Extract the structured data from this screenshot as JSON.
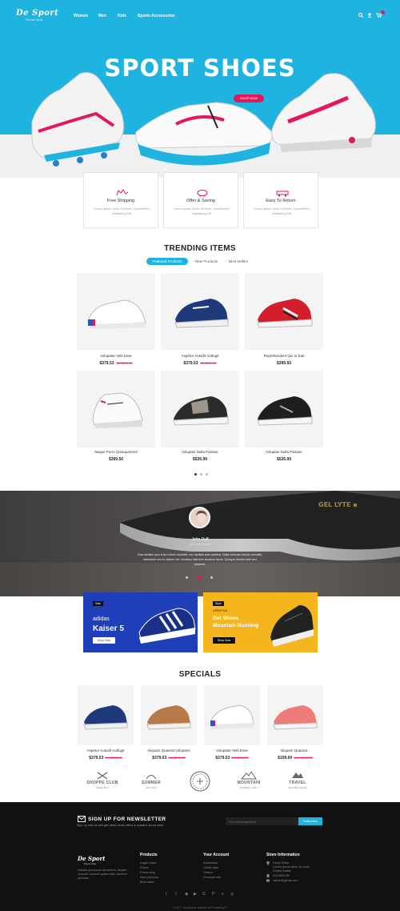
{
  "header": {
    "logo": "De Sport",
    "logo_sub": "Finest Club",
    "nav": [
      "Women",
      "Men",
      "Kids",
      "Sports Accessories"
    ],
    "icons": [
      "search-icon",
      "user-icon",
      "cart-icon"
    ]
  },
  "hero": {
    "title": "SPORT SHOES",
    "button": "SHOP NOW"
  },
  "features": [
    {
      "title": "Free Shipping",
      "desc": "Lorem ipsum Dolor Sit Amet, Consectetur Adipiscing Elit",
      "icon": "truck-icon"
    },
    {
      "title": "Offer & Saving",
      "desc": "Lorem ipsum Dolor Sit Amet, Consectetur Adipiscing Elit",
      "icon": "piggy-bank-icon"
    },
    {
      "title": "Easy To Return",
      "desc": "Lorem ipsum Dolor Sit Amet, Consectetur Adipiscing Elit",
      "icon": "return-icon"
    }
  ],
  "trending": {
    "title": "TRENDING ITEMS",
    "tabs": [
      "Featured Products",
      "New Products",
      "Best Sellers"
    ],
    "products": [
      {
        "name": "Voluptate Velit Esse",
        "price": "$379.53",
        "old_price": "$5 $399.50"
      },
      {
        "name": "Aspetur Autodit Autfugit",
        "price": "$379.53",
        "old_price": "$5 $399.50"
      },
      {
        "name": "Reprehenderit Qui In Eait",
        "price": "$399.50",
        "old_price": ""
      },
      {
        "name": "Neque Porro Quisquament",
        "price": "$399.50",
        "old_price": ""
      },
      {
        "name": "Voluptas Nulla Pariatur",
        "price": "$526.99",
        "old_price": ""
      },
      {
        "name": "Voluptas Nulla Pariatur",
        "price": "$526.99",
        "old_price": ""
      }
    ]
  },
  "testimonial": {
    "name": "John Duff",
    "role": "CEO and founder",
    "quote": "Duis facilisis arcu a leo rutrum molestie, nec facilisis ante pulvinar. Nulla vehicula mauris convallis, bibendum orci in, dictum est. Vivamus interdum faucibus lacus. Quisque laoreet ante sed placerat."
  },
  "banners": [
    {
      "tag": "Sale",
      "line1": "adidas",
      "line2": "Kaiser 5",
      "button": "Shop Now"
    },
    {
      "tag": "Style",
      "kicker": "LIFESTYLE",
      "line1": "Get Shoes",
      "line2": "Mountain Running",
      "button": "Shop Now"
    }
  ],
  "specials": {
    "title": "SPECIALS",
    "products": [
      {
        "name": "Aspetur Autodit Autfugit",
        "price": "$379.53",
        "old_price": "5% $399.50"
      },
      {
        "name": "Aliquam Quaerat Voluptem",
        "price": "$379.53",
        "old_price": "5% $399.50"
      },
      {
        "name": "Voluptate Velit Esse",
        "price": "$379.53",
        "old_price": "5% $399.50"
      },
      {
        "name": "Aliquam Quaerat...",
        "price": "$159.60",
        "old_price": "20% $199.50"
      }
    ]
  },
  "brands": [
    {
      "name": "SHOPPE CLUB",
      "sub": "SINCE 2017"
    },
    {
      "name": "SUMMER",
      "sub": "EST. 2017"
    },
    {
      "name": "",
      "sub": ""
    },
    {
      "name": "MOUNTAIN",
      "sub": "CLIMBING • 2017"
    },
    {
      "name": "TRAVEL",
      "sub": "WALKING SHOES"
    }
  ],
  "footer": {
    "newsletter_title": "SIGN UP FOR NEWSLETTER",
    "newsletter_desc": "Sign up with us and get latest deals,offers & updates about store.",
    "input_placeholder": "Your email address",
    "subscribe": "Subscribe",
    "about": "Claritas processus dynamicus, sequitu consuet, consuet system alter ulmeleni pecunes.",
    "products_title": "Products",
    "products_links": [
      "Legal notice",
      "Prices",
      "Prices drop",
      "New products",
      "Best sales"
    ],
    "account_title": "Your Account",
    "account_links": [
      "Addresses",
      "Credit slips",
      "Orders",
      "Personal info"
    ],
    "store_title": "Store Information",
    "store_lines": [
      "Demo Store",
      "Lorem ipsum dolor sit amet",
      "United States",
      "0123654789",
      "admin@gmail.com"
    ],
    "social_icons": [
      "facebook-icon",
      "twitter-icon",
      "rss-icon",
      "youtube-icon",
      "google-plus-icon",
      "pinterest-icon",
      "vimeo-icon",
      "instagram-icon"
    ],
    "copyright": "© 2017 - Ecommerce software by PrestaShop™"
  },
  "colors": {
    "accent": "#1fb3e0",
    "brand_pink": "#e0195c",
    "dark": "#111111"
  }
}
